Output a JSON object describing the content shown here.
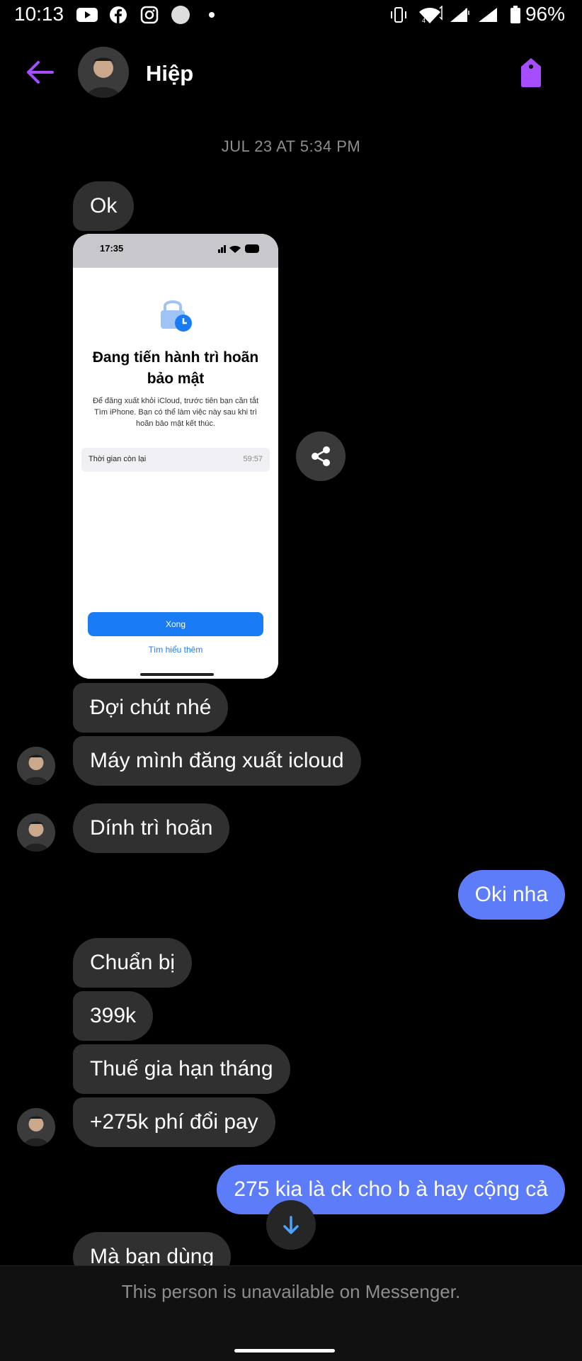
{
  "status_bar": {
    "time": "10:13",
    "battery": "96%"
  },
  "header": {
    "contact_name": "Hiệp"
  },
  "timestamp": "JUL 23 AT 5:34 PM",
  "shared_screenshot": {
    "time": "17:35",
    "title_line1": "Đang tiến hành trì hoãn",
    "title_line2": "bảo mật",
    "description": "Để đăng xuất khỏi iCloud, trước tiên bạn cần tắt Tìm iPhone. Bạn có thể làm việc này sau khi trì hoãn bảo mật kết thúc.",
    "row_label": "Thời gian còn lại",
    "row_value": "59:57",
    "button_label": "Xong",
    "link_label": "Tìm hiểu thêm"
  },
  "messages": [
    {
      "text": "Ok",
      "direction": "in"
    },
    {
      "text": "Đợi chút nhé",
      "direction": "in"
    },
    {
      "text": "Máy mình đăng xuất icloud",
      "direction": "in"
    },
    {
      "text": "Dính trì hoãn",
      "direction": "in"
    },
    {
      "text": "Oki nha",
      "direction": "out"
    },
    {
      "text": "Chuẩn bị",
      "direction": "in"
    },
    {
      "text": "399k",
      "direction": "in"
    },
    {
      "text": "Thuế gia hạn tháng",
      "direction": "in"
    },
    {
      "text": "+275k phí đổi pay",
      "direction": "in"
    },
    {
      "text": "275 kia là ck cho b à hay cộng cả",
      "direction": "out"
    },
    {
      "text": "Mà bạn dùng",
      "direction": "in"
    }
  ],
  "footer": {
    "notice": "This person is unavailable on Messenger."
  },
  "colors": {
    "accent": "#a64dff",
    "outgoing_bubble": "#5c7cfa",
    "incoming_bubble": "#303030",
    "background": "#000000"
  },
  "icons": [
    "back-arrow-icon",
    "tag-icon",
    "share-icon",
    "scroll-down-icon",
    "avatar"
  ]
}
